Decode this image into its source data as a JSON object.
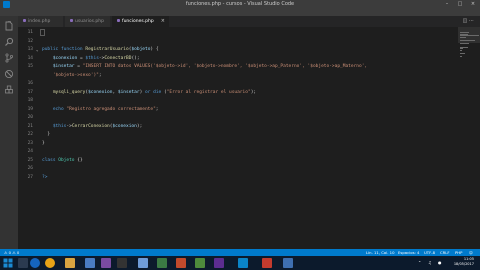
{
  "window": {
    "title": "funciones.php - cursos - Visual Studio Code"
  },
  "menu": [
    "Archivo",
    "Editar",
    "Selección",
    "Ver",
    "Ir",
    "Depurar",
    "Ayuda"
  ],
  "activity": [
    "files-icon",
    "search-icon",
    "source-control-icon",
    "debug-icon",
    "extensions-icon"
  ],
  "tabs": [
    {
      "label": "index.php",
      "active": false
    },
    {
      "label": "usuarios.php",
      "active": false
    },
    {
      "label": "funciones.php",
      "active": true
    }
  ],
  "editor": {
    "lines": [
      {
        "n": "11",
        "tokens": []
      },
      {
        "n": "12",
        "tokens": []
      },
      {
        "n": "13",
        "tokens": [
          {
            "t": "public function ",
            "c": "#569cd6"
          },
          {
            "t": "RegistrarUsuario",
            "c": "#dcdcaa"
          },
          {
            "t": "(",
            "c": "#d4d4d4"
          },
          {
            "t": "$objeto",
            "c": "#9cdcfe"
          },
          {
            "t": ") {",
            "c": "#d4d4d4"
          }
        ]
      },
      {
        "n": "14",
        "tokens": [
          {
            "t": "    $conexion",
            "c": "#9cdcfe"
          },
          {
            "t": " = ",
            "c": "#d4d4d4"
          },
          {
            "t": "$this",
            "c": "#569cd6"
          },
          {
            "t": "->",
            "c": "#d4d4d4"
          },
          {
            "t": "ConectarBD",
            "c": "#dcdcaa"
          },
          {
            "t": "();",
            "c": "#d4d4d4"
          }
        ]
      },
      {
        "n": "15",
        "tokens": [
          {
            "t": "    $insetar",
            "c": "#9cdcfe"
          },
          {
            "t": " = ",
            "c": "#d4d4d4"
          },
          {
            "t": "\"INSERT INTO datos VALUES('$objeto->id', '$objeto->nombre', '$objeto->ap_Paterno', '$objeto->ap_Materno',",
            "c": "#ce9178"
          }
        ]
      },
      {
        "n": "",
        "tokens": [
          {
            "t": "    '$objeto->sexo')\"",
            "c": "#ce9178"
          },
          {
            "t": ";",
            "c": "#d4d4d4"
          }
        ]
      },
      {
        "n": "16",
        "tokens": []
      },
      {
        "n": "17",
        "tokens": [
          {
            "t": "    mysqli_query",
            "c": "#dcdcaa"
          },
          {
            "t": "(",
            "c": "#d4d4d4"
          },
          {
            "t": "$conexion",
            "c": "#9cdcfe"
          },
          {
            "t": ", ",
            "c": "#d4d4d4"
          },
          {
            "t": "$insetar",
            "c": "#9cdcfe"
          },
          {
            "t": ") ",
            "c": "#d4d4d4"
          },
          {
            "t": "or die ",
            "c": "#569cd6"
          },
          {
            "t": "(",
            "c": "#d4d4d4"
          },
          {
            "t": "\"Error al registrar el usuario\"",
            "c": "#ce9178"
          },
          {
            "t": ");",
            "c": "#d4d4d4"
          }
        ]
      },
      {
        "n": "18",
        "tokens": []
      },
      {
        "n": "19",
        "tokens": [
          {
            "t": "    echo ",
            "c": "#569cd6"
          },
          {
            "t": "\"Registro agregado correctamente\"",
            "c": "#ce9178"
          },
          {
            "t": ";",
            "c": "#d4d4d4"
          }
        ]
      },
      {
        "n": "20",
        "tokens": []
      },
      {
        "n": "21",
        "tokens": [
          {
            "t": "    $this",
            "c": "#569cd6"
          },
          {
            "t": "->",
            "c": "#d4d4d4"
          },
          {
            "t": "CerrarConexion",
            "c": "#dcdcaa"
          },
          {
            "t": "(",
            "c": "#d4d4d4"
          },
          {
            "t": "$conexion",
            "c": "#9cdcfe"
          },
          {
            "t": ");",
            "c": "#d4d4d4"
          }
        ]
      },
      {
        "n": "22",
        "tokens": [
          {
            "t": "  }",
            "c": "#d4d4d4"
          }
        ]
      },
      {
        "n": "23",
        "tokens": [
          {
            "t": "}",
            "c": "#d4d4d4"
          }
        ]
      },
      {
        "n": "24",
        "tokens": []
      },
      {
        "n": "25",
        "tokens": [
          {
            "t": "class ",
            "c": "#569cd6"
          },
          {
            "t": "Objeto",
            "c": "#4ec9b0"
          },
          {
            "t": " {}",
            "c": "#d4d4d4"
          }
        ]
      },
      {
        "n": "26",
        "tokens": []
      },
      {
        "n": "27",
        "tokens": [
          {
            "t": "?>",
            "c": "#569cd6"
          }
        ]
      }
    ]
  },
  "status": {
    "position": "Lín. 11, Col. 10",
    "spaces": "Espacios: 4",
    "encoding": "UTF-8",
    "eol": "CRLF",
    "language": "PHP"
  },
  "taskbar": {
    "time": "11:05",
    "date": "18/05/2017"
  }
}
